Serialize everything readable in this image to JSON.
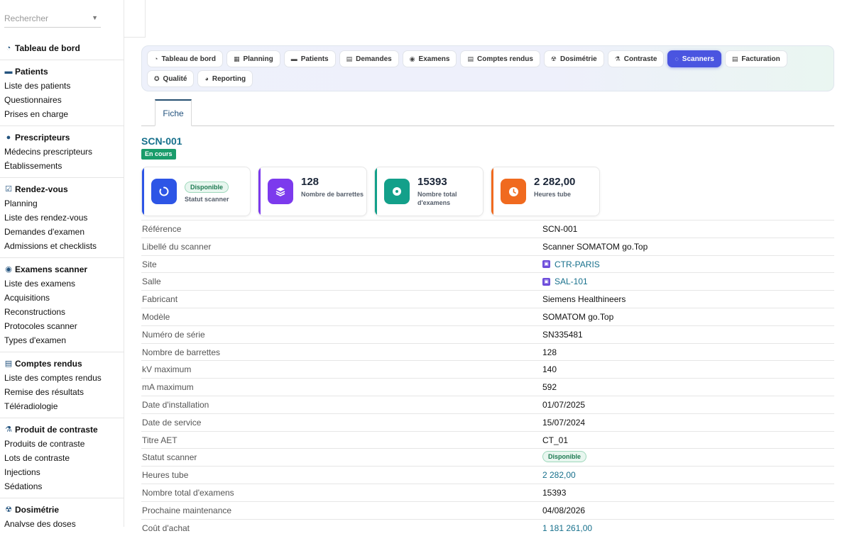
{
  "search": {
    "placeholder": "Rechercher"
  },
  "sidebar": {
    "groups": [
      {
        "label": "Tableau de bord",
        "icon": "gauge-icon",
        "items": []
      },
      {
        "label": "Patients",
        "icon": "bed-icon",
        "items": [
          "Liste des patients",
          "Questionnaires",
          "Prises en charge"
        ]
      },
      {
        "label": "Prescripteurs",
        "icon": "users-icon",
        "items": [
          "Médecins prescripteurs",
          "Établissements"
        ]
      },
      {
        "label": "Rendez-vous",
        "icon": "calendar-check-icon",
        "items": [
          "Planning",
          "Liste des rendez-vous",
          "Demandes d'examen",
          "Admissions et checklists"
        ]
      },
      {
        "label": "Examens scanner",
        "icon": "disc-icon",
        "items": [
          "Liste des examens",
          "Acquisitions",
          "Reconstructions",
          "Protocoles scanner",
          "Types d'examen"
        ]
      },
      {
        "label": "Comptes rendus",
        "icon": "file-icon",
        "items": [
          "Liste des comptes rendus",
          "Remise des résultats",
          "Téléradiologie"
        ]
      },
      {
        "label": "Produit de contraste",
        "icon": "flask-icon",
        "items": [
          "Produits de contraste",
          "Lots de contraste",
          "Injections",
          "Sédations"
        ]
      },
      {
        "label": "Dosimétrie",
        "icon": "radiation-icon",
        "items": [
          "Analyse des doses"
        ]
      }
    ]
  },
  "tabs": [
    {
      "label": "Tableau de bord",
      "icon": "gauge-icon",
      "active": false
    },
    {
      "label": "Planning",
      "icon": "calendar-icon",
      "active": false
    },
    {
      "label": "Patients",
      "icon": "bed-icon",
      "active": false
    },
    {
      "label": "Demandes",
      "icon": "file-icon",
      "active": false
    },
    {
      "label": "Examens",
      "icon": "disc-icon",
      "active": false
    },
    {
      "label": "Comptes rendus",
      "icon": "file-lines-icon",
      "active": false
    },
    {
      "label": "Dosimétrie",
      "icon": "radiation-icon",
      "active": false
    },
    {
      "label": "Contraste",
      "icon": "flask-icon",
      "active": false
    },
    {
      "label": "Scanners",
      "icon": "circle-notch-icon",
      "active": true
    },
    {
      "label": "Facturation",
      "icon": "invoice-icon",
      "active": false
    },
    {
      "label": "Qualité",
      "icon": "award-icon",
      "active": false
    },
    {
      "label": "Reporting",
      "icon": "chart-pie-icon",
      "active": false
    }
  ],
  "subtab": {
    "label": "Fiche"
  },
  "record": {
    "title": "SCN-001",
    "status": "En cours"
  },
  "cards": [
    {
      "kind": "status",
      "value": "Disponible",
      "label": "Statut scanner",
      "color": "#2d55e6",
      "icon": "circle-notch-icon"
    },
    {
      "kind": "number",
      "value": "128",
      "label": "Nombre de barrettes",
      "color": "#7c3aed",
      "icon": "layers-icon"
    },
    {
      "kind": "number",
      "value": "15393",
      "label": "Nombre total d'examens",
      "color": "#13a08a",
      "icon": "disc-icon"
    },
    {
      "kind": "number",
      "value": "2 282,00",
      "label": "Heures tube",
      "color": "#f06a1f",
      "icon": "clock-icon"
    }
  ],
  "fields": [
    {
      "label": "Référence",
      "value": "SCN-001",
      "style": "plain"
    },
    {
      "label": "Libellé du scanner",
      "value": "Scanner SOMATOM go.Top",
      "style": "plain"
    },
    {
      "label": "Site",
      "value": "CTR-PARIS",
      "style": "link"
    },
    {
      "label": "Salle",
      "value": "SAL-101",
      "style": "link"
    },
    {
      "label": "Fabricant",
      "value": "Siemens Healthineers",
      "style": "plain"
    },
    {
      "label": "Modèle",
      "value": "SOMATOM go.Top",
      "style": "plain"
    },
    {
      "label": "Numéro de série",
      "value": "SN335481",
      "style": "plain"
    },
    {
      "label": "Nombre de barrettes",
      "value": "128",
      "style": "plain"
    },
    {
      "label": "kV maximum",
      "value": "140",
      "style": "plain"
    },
    {
      "label": "mA maximum",
      "value": "592",
      "style": "plain"
    },
    {
      "label": "Date d'installation",
      "value": "01/07/2025",
      "style": "plain"
    },
    {
      "label": "Date de service",
      "value": "15/07/2024",
      "style": "plain"
    },
    {
      "label": "Titre AET",
      "value": "CT_01",
      "style": "plain"
    },
    {
      "label": "Statut scanner",
      "value": "Disponible",
      "style": "pill"
    },
    {
      "label": "Heures tube",
      "value": "2 282,00",
      "style": "teal"
    },
    {
      "label": "Nombre total d'examens",
      "value": "15393",
      "style": "plain"
    },
    {
      "label": "Prochaine maintenance",
      "value": "04/08/2026",
      "style": "plain"
    },
    {
      "label": "Coût d'achat",
      "value": "1 181 261,00",
      "style": "teal"
    }
  ]
}
